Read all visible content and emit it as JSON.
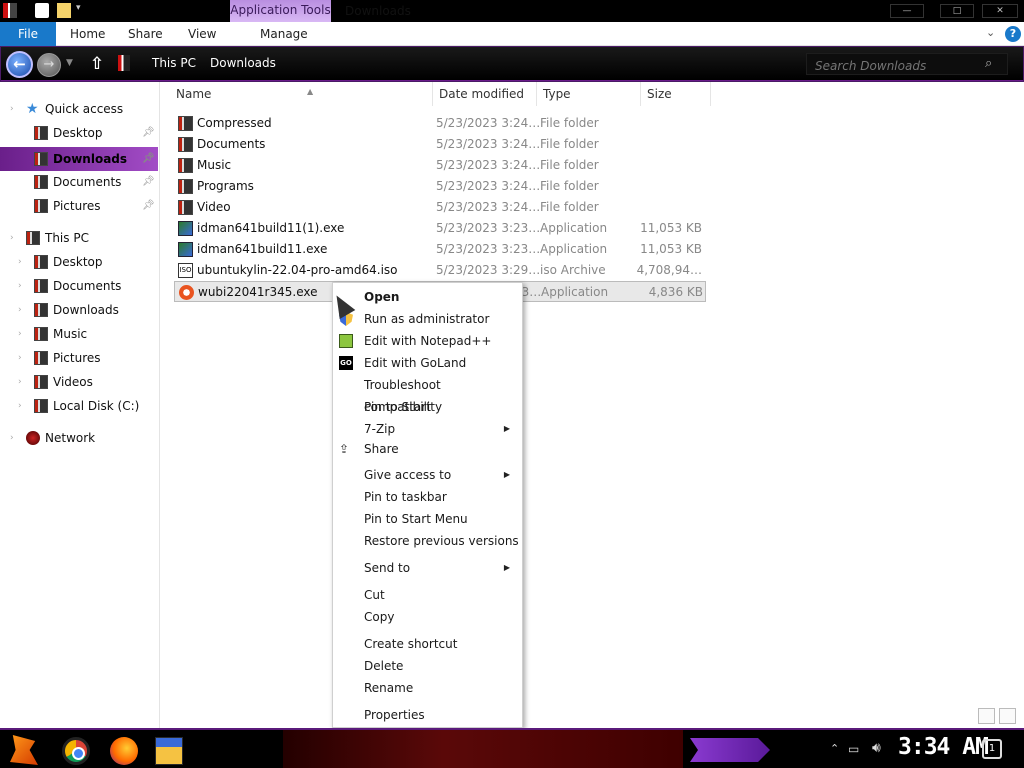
{
  "window": {
    "title": "Downloads",
    "contextual_tab_group": "Application Tools",
    "controls": {
      "minimize": "—",
      "maximize": "□",
      "close": "✕"
    }
  },
  "ribbon": {
    "file_tab": "File",
    "tabs": [
      "Home",
      "Share",
      "View",
      "Manage"
    ],
    "help": "?"
  },
  "address_bar": {
    "breadcrumbs": [
      "This PC",
      "Downloads"
    ],
    "search_placeholder": "Search Downloads"
  },
  "sidebar": {
    "items": [
      {
        "label": "Quick access",
        "pinned": false
      },
      {
        "label": "Desktop",
        "pinned": true
      },
      {
        "label": "Downloads",
        "pinned": true,
        "selected": true
      },
      {
        "label": "Documents",
        "pinned": true
      },
      {
        "label": "Pictures",
        "pinned": true
      },
      {
        "label": "This PC",
        "pinned": false
      },
      {
        "label": "Desktop",
        "pinned": false
      },
      {
        "label": "Documents",
        "pinned": false
      },
      {
        "label": "Downloads",
        "pinned": false
      },
      {
        "label": "Music",
        "pinned": false
      },
      {
        "label": "Pictures",
        "pinned": false
      },
      {
        "label": "Videos",
        "pinned": false
      },
      {
        "label": "Local Disk (C:)",
        "pinned": false
      },
      {
        "label": "Network",
        "pinned": false
      }
    ]
  },
  "columns": [
    "Name",
    "Date modified",
    "Type",
    "Size"
  ],
  "files": [
    {
      "name": "Compressed",
      "date": "5/23/2023 3:24…",
      "type": "File folder",
      "size": "",
      "icon": "folder-icon"
    },
    {
      "name": "Documents",
      "date": "5/23/2023 3:24…",
      "type": "File folder",
      "size": "",
      "icon": "folder-icon"
    },
    {
      "name": "Music",
      "date": "5/23/2023 3:24…",
      "type": "File folder",
      "size": "",
      "icon": "folder-icon"
    },
    {
      "name": "Programs",
      "date": "5/23/2023 3:24…",
      "type": "File folder",
      "size": "",
      "icon": "folder-icon"
    },
    {
      "name": "Video",
      "date": "5/23/2023 3:24…",
      "type": "File folder",
      "size": "",
      "icon": "folder-icon"
    },
    {
      "name": "idman641build11(1).exe",
      "date": "5/23/2023 3:23…",
      "type": "Application",
      "size": "11,053 KB",
      "icon": "installer-icon"
    },
    {
      "name": "idman641build11.exe",
      "date": "5/23/2023 3:23…",
      "type": "Application",
      "size": "11,053 KB",
      "icon": "installer-icon"
    },
    {
      "name": "ubuntukylin-22.04-pro-amd64.iso",
      "date": "5/23/2023 3:29…",
      "type": "iso Archive",
      "size": "4,708,94…",
      "icon": "iso-icon"
    },
    {
      "name": "wubi22041r345.exe",
      "date": "5/23/2023 3:23…",
      "type": "Application",
      "size": "4,836 KB",
      "icon": "ubuntu-icon",
      "selected": true
    }
  ],
  "context_menu": {
    "items": [
      {
        "label": "Open",
        "bold": true,
        "icon": "",
        "submenu": false
      },
      {
        "label": "Run as administrator",
        "icon": "shield-icon",
        "submenu": false
      },
      {
        "label": "Edit with Notepad++",
        "icon": "notepad-plus-plus-icon",
        "submenu": false
      },
      {
        "label": "Edit with GoLand",
        "icon": "goland-icon",
        "submenu": false
      },
      {
        "label": "Troubleshoot compatibility",
        "icon": "",
        "submenu": false
      },
      {
        "label": "Pin to Start",
        "icon": "",
        "submenu": false
      },
      {
        "label": "7-Zip",
        "icon": "",
        "submenu": true
      },
      {
        "label": "Share",
        "icon": "share-icon",
        "submenu": false
      },
      {
        "label": "Give access to",
        "icon": "",
        "submenu": true
      },
      {
        "label": "Pin to taskbar",
        "icon": "",
        "submenu": false
      },
      {
        "label": "Pin to Start Menu",
        "icon": "",
        "submenu": false
      },
      {
        "label": "Restore previous versions",
        "icon": "",
        "submenu": false
      },
      {
        "label": "Send to",
        "icon": "",
        "submenu": true
      },
      {
        "label": "Cut",
        "icon": "",
        "submenu": false
      },
      {
        "label": "Copy",
        "icon": "",
        "submenu": false
      },
      {
        "label": "Create shortcut",
        "icon": "",
        "submenu": false
      },
      {
        "label": "Delete",
        "icon": "",
        "submenu": false
      },
      {
        "label": "Rename",
        "icon": "",
        "submenu": false
      },
      {
        "label": "Properties",
        "icon": "",
        "submenu": false
      }
    ]
  },
  "taskbar": {
    "apps": [
      "start-icon",
      "chrome-icon",
      "firefox-icon",
      "file-explorer-icon"
    ],
    "clock": "3:34 AM",
    "notification_count": "1"
  },
  "colors": {
    "accent_purple": "#8a3ab8",
    "file_tab_blue": "#1979ca",
    "taskbar_bg": "#000000"
  }
}
